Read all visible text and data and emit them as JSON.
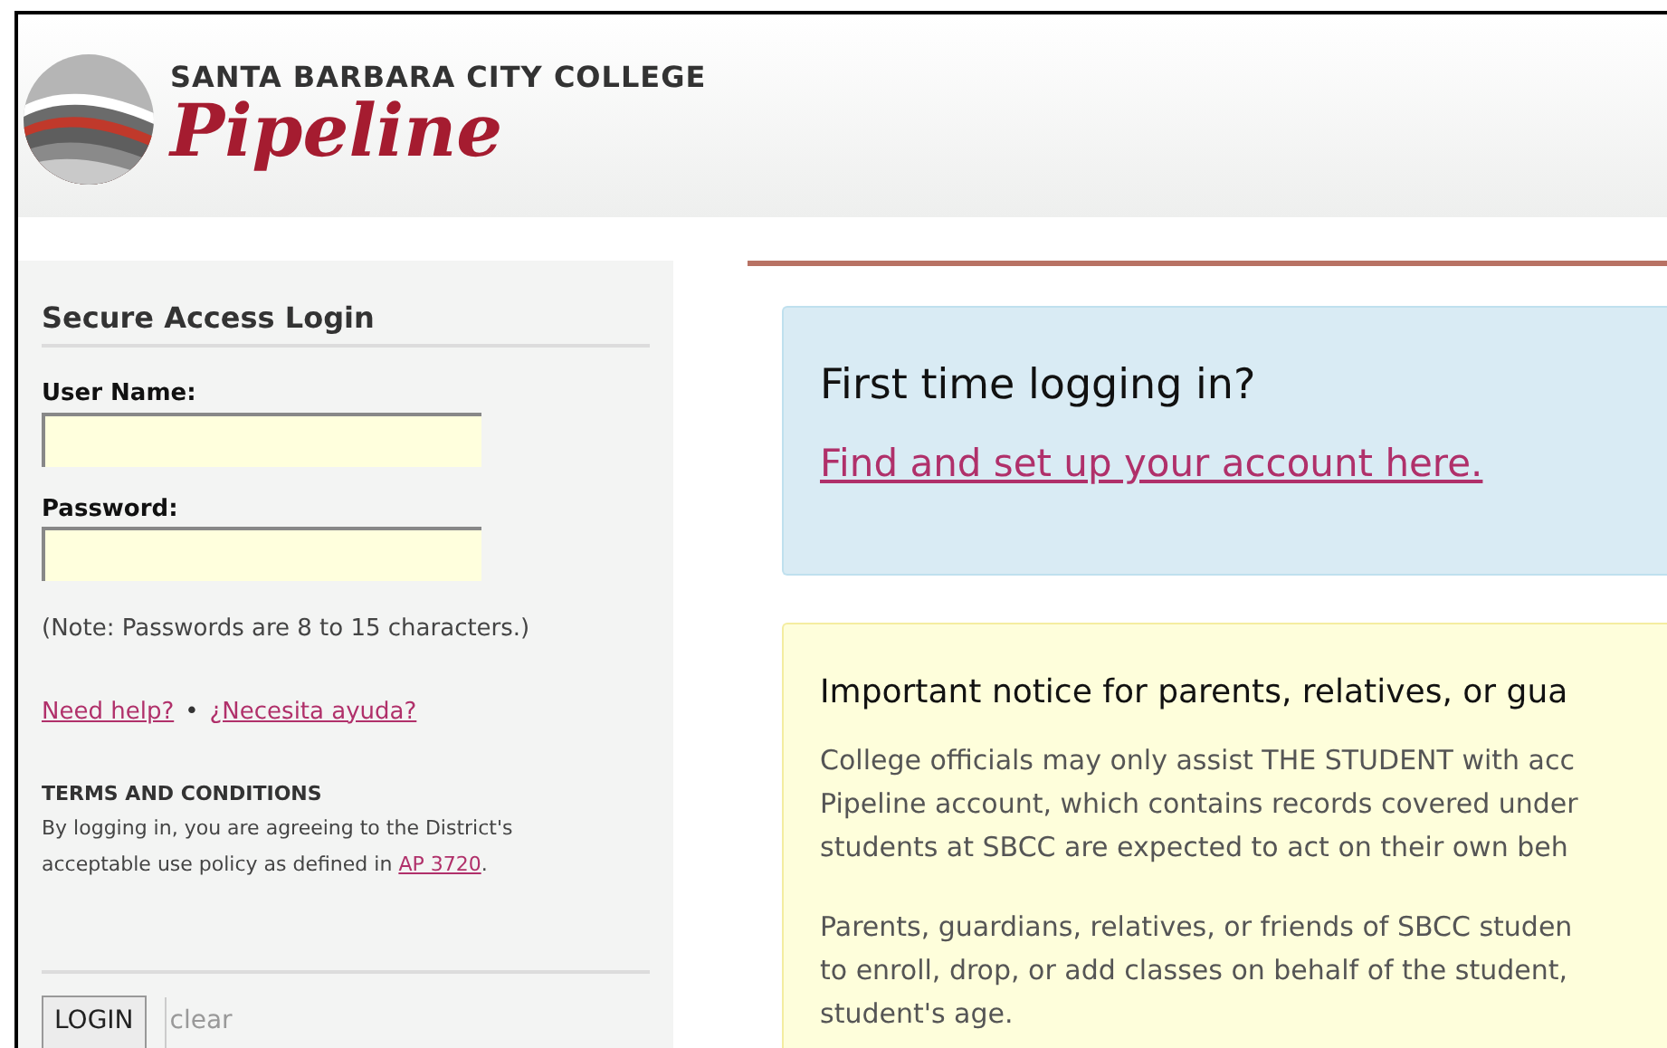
{
  "header": {
    "college": "SANTA BARBARA CITY COLLEGE",
    "app_name": "Pipeline"
  },
  "login": {
    "title": "Secure Access Login",
    "fields": [
      {
        "label": "User Name:"
      },
      {
        "label": "Password:"
      }
    ],
    "note": "(Note: Passwords are 8 to 15 characters.)",
    "help_links": [
      "Need help?",
      "¿Necesita ayuda?"
    ],
    "separator": "•",
    "terms_title": "TERMS AND CONDITIONS",
    "terms_text": "By logging in, you are agreeing to the District's acceptable use policy as defined in",
    "terms_link": "AP 3720",
    "terms_end": ".",
    "login_button": "LOGIN",
    "clear_link": "clear"
  },
  "first_time": {
    "title": "First time logging in?",
    "link": "Find and set up your account here."
  },
  "notice": {
    "title": "Important notice for parents, relatives, or gua",
    "paragraphs": [
      [
        "College officials may only assist THE STUDENT with acc",
        "Pipeline account, which contains records covered under",
        "students at SBCC are expected to act on their own beh"
      ],
      [
        "Parents, guardians, relatives, or friends of SBCC studen",
        "to enroll, drop, or add classes on behalf of the student,",
        "student's age."
      ]
    ]
  }
}
